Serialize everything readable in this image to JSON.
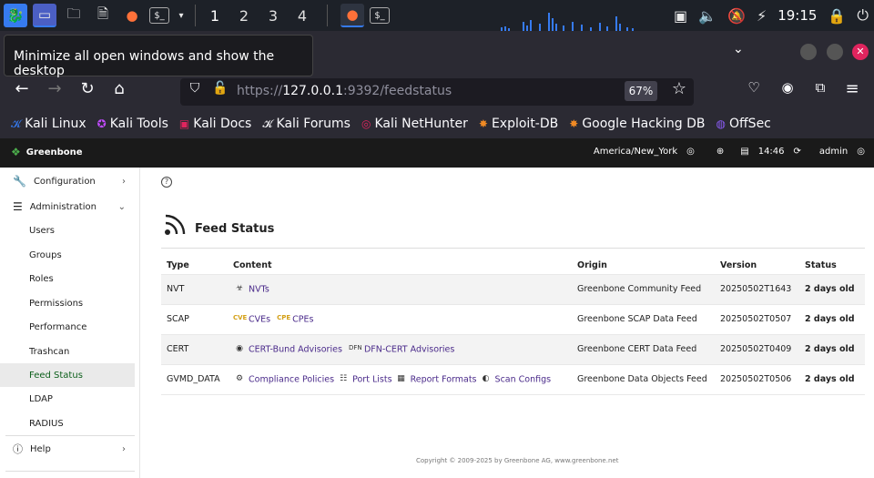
{
  "taskbar": {
    "workspaces": [
      "1",
      "2",
      "3",
      "4"
    ],
    "clock": "19:15"
  },
  "tooltip": {
    "text": "Minimize all open windows and show the desktop"
  },
  "browser": {
    "url_prefix": "https://",
    "url_host": "127.0.0.1",
    "url_rest": ":9392/feedstatus",
    "zoom": "67%",
    "bookmarks": [
      {
        "label": "Kali Linux",
        "icon": "kali-dragon-icon"
      },
      {
        "label": "Kali Tools",
        "icon": "kali-tools-icon"
      },
      {
        "label": "Kali Docs",
        "icon": "kali-docs-icon"
      },
      {
        "label": "Kali Forums",
        "icon": "kali-forums-icon"
      },
      {
        "label": "Kali NetHunter",
        "icon": "nethunter-icon"
      },
      {
        "label": "Exploit-DB",
        "icon": "exploit-db-icon"
      },
      {
        "label": "Google Hacking DB",
        "icon": "ghdb-icon"
      },
      {
        "label": "OffSec",
        "icon": "offsec-icon"
      }
    ]
  },
  "gsa": {
    "brand": "Greenbone",
    "timezone": "America/New_York",
    "time": "14:46",
    "user": "admin"
  },
  "sidebar": {
    "configuration": "Configuration",
    "administration": "Administration",
    "sub": [
      "Users",
      "Groups",
      "Roles",
      "Permissions",
      "Performance",
      "Trashcan",
      "Feed Status",
      "LDAP",
      "RADIUS"
    ],
    "help": "Help"
  },
  "page": {
    "title": "Feed Status",
    "columns": [
      "Type",
      "Content",
      "Origin",
      "Version",
      "Status"
    ],
    "rows": [
      {
        "type": "NVT",
        "content": [
          {
            "label": "NVTs",
            "icon": "nvt-biohazard-icon"
          }
        ],
        "origin": "Greenbone Community Feed",
        "version": "20250502T1643",
        "status": "2 days old"
      },
      {
        "type": "SCAP",
        "content": [
          {
            "label": "CVEs",
            "icon": "cve-icon"
          },
          {
            "label": "CPEs",
            "icon": "cpe-icon"
          }
        ],
        "origin": "Greenbone SCAP Data Feed",
        "version": "20250502T0507",
        "status": "2 days old"
      },
      {
        "type": "CERT",
        "content": [
          {
            "label": "CERT-Bund Advisories",
            "icon": "cert-bund-icon"
          },
          {
            "label": "DFN-CERT Advisories",
            "icon": "dfn-cert-icon"
          }
        ],
        "origin": "Greenbone CERT Data Feed",
        "version": "20250502T0409",
        "status": "2 days old"
      },
      {
        "type": "GVMD_DATA",
        "content": [
          {
            "label": "Compliance Policies",
            "icon": "policy-icon"
          },
          {
            "label": "Port Lists",
            "icon": "port-list-icon"
          },
          {
            "label": "Report Formats",
            "icon": "report-format-icon"
          },
          {
            "label": "Scan Configs",
            "icon": "scan-config-icon"
          }
        ],
        "origin": "Greenbone Data Objects Feed",
        "version": "20250502T0506",
        "status": "2 days old"
      }
    ]
  },
  "footer": "Copyright © 2009-2025 by Greenbone AG, www.greenbone.net"
}
